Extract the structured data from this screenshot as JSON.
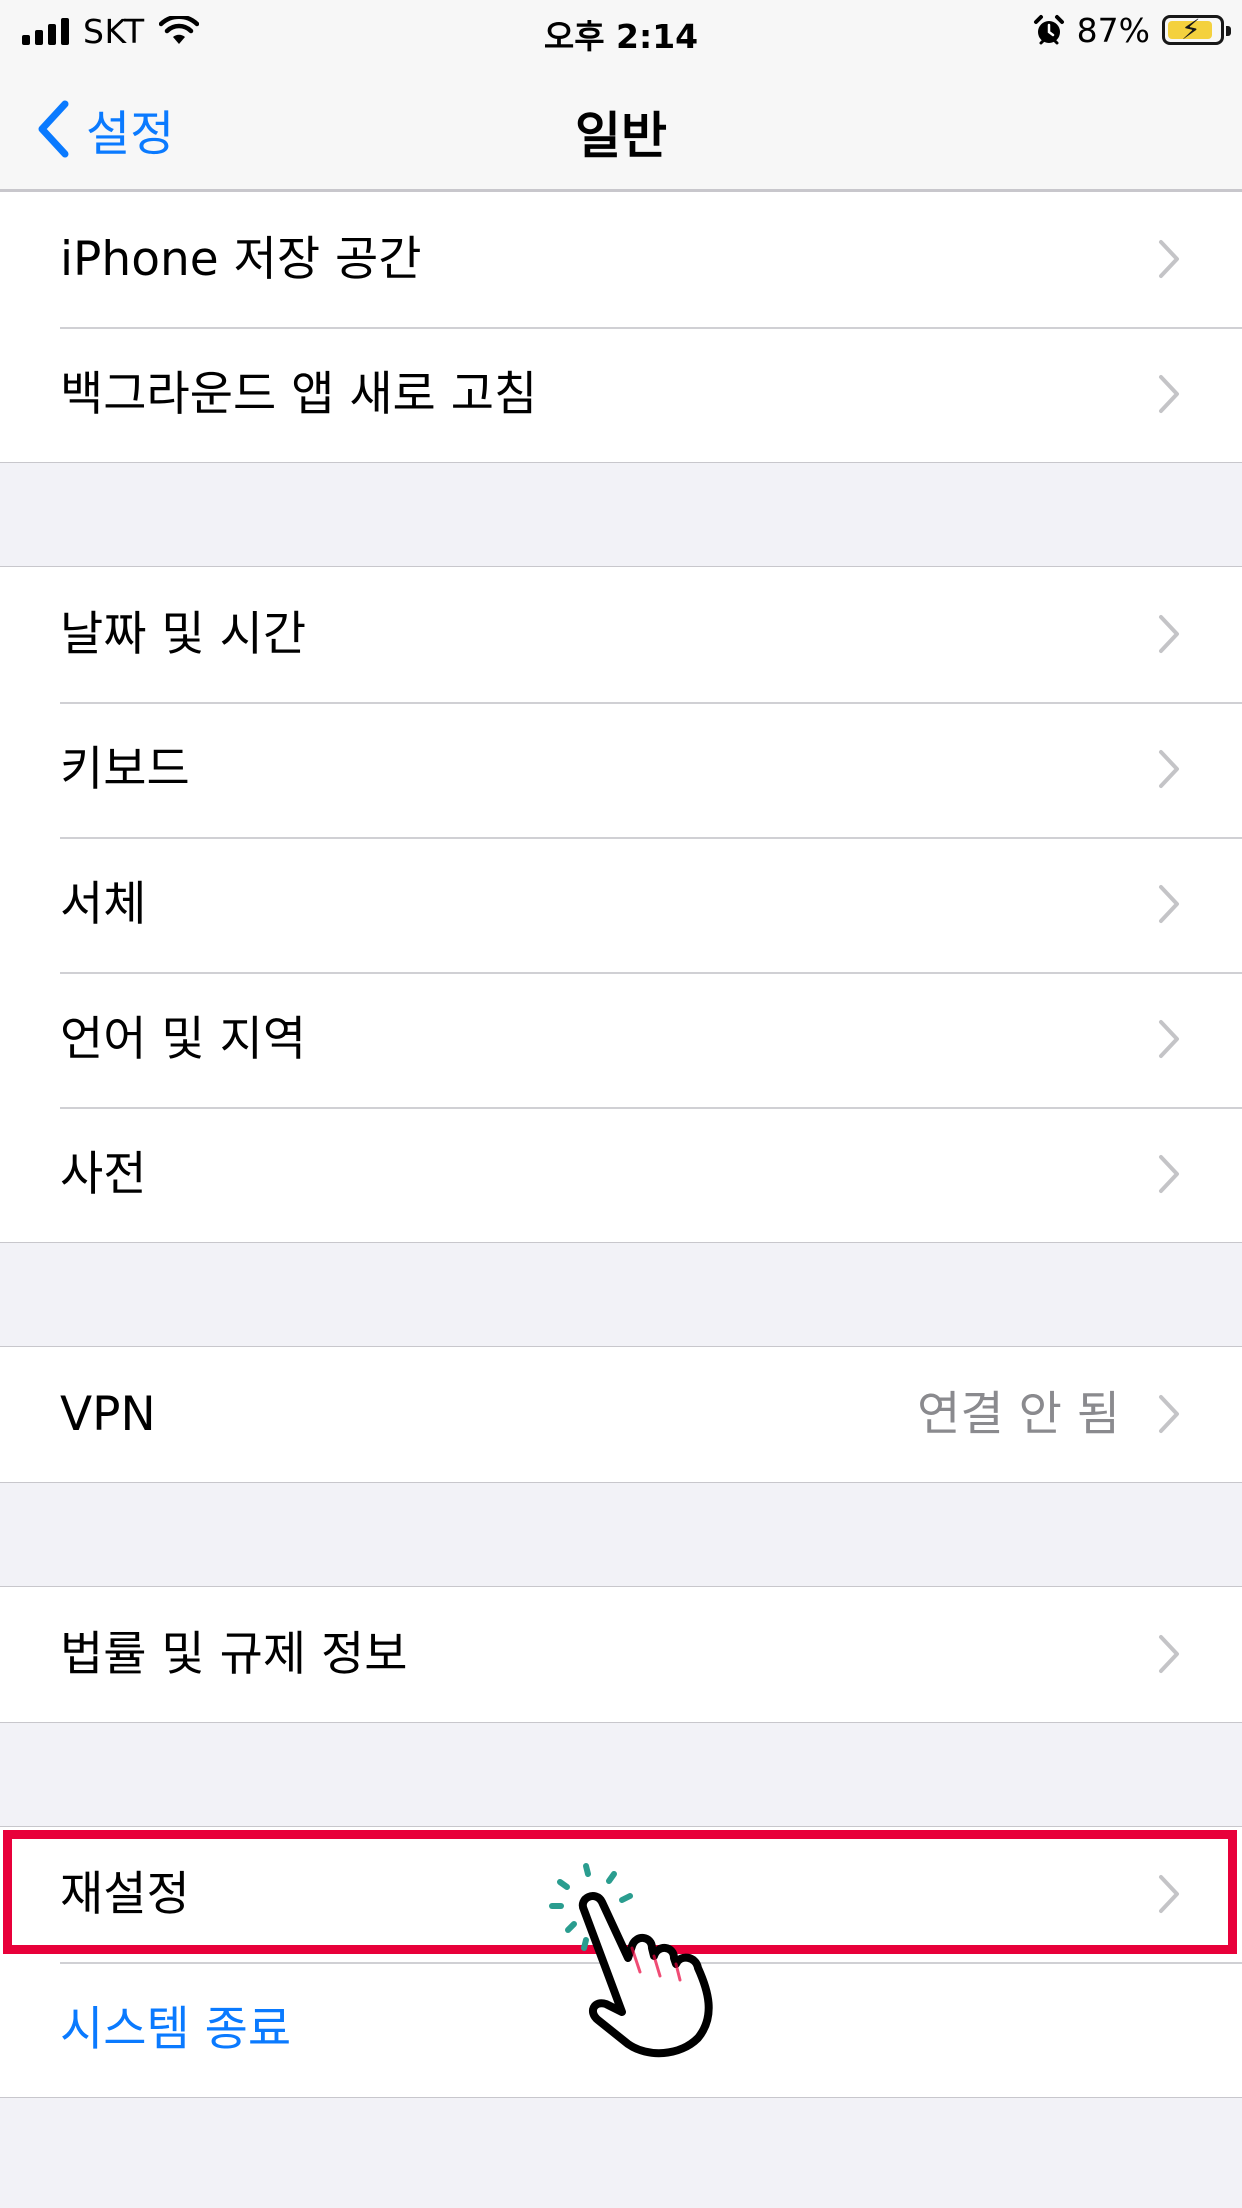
{
  "status_bar": {
    "carrier": "SKT",
    "time": "오후 2:14",
    "battery_percent": "87%",
    "battery_level": 0.87,
    "icons": [
      "signal-icon",
      "wifi-icon",
      "alarm-icon",
      "battery-charging-icon"
    ]
  },
  "nav": {
    "back_label": "설정",
    "title": "일반"
  },
  "groups": [
    {
      "items": [
        {
          "label": "iPhone 저장 공간"
        },
        {
          "label": "백그라운드 앱 새로 고침"
        }
      ]
    },
    {
      "items": [
        {
          "label": "날짜 및 시간"
        },
        {
          "label": "키보드"
        },
        {
          "label": "서체"
        },
        {
          "label": "언어 및 지역"
        },
        {
          "label": "사전"
        }
      ]
    },
    {
      "items": [
        {
          "label": "VPN",
          "value": "연결 안 됨"
        }
      ]
    },
    {
      "items": [
        {
          "label": "법률 및 규제 정보"
        }
      ]
    },
    {
      "items": [
        {
          "label": "재설정"
        },
        {
          "label": "시스템 종료"
        }
      ]
    }
  ],
  "colors": {
    "accent": "#0a7aff",
    "highlight": "#e8003a",
    "background": "#f2f2f7",
    "secondary_text": "#8a8a8e"
  }
}
